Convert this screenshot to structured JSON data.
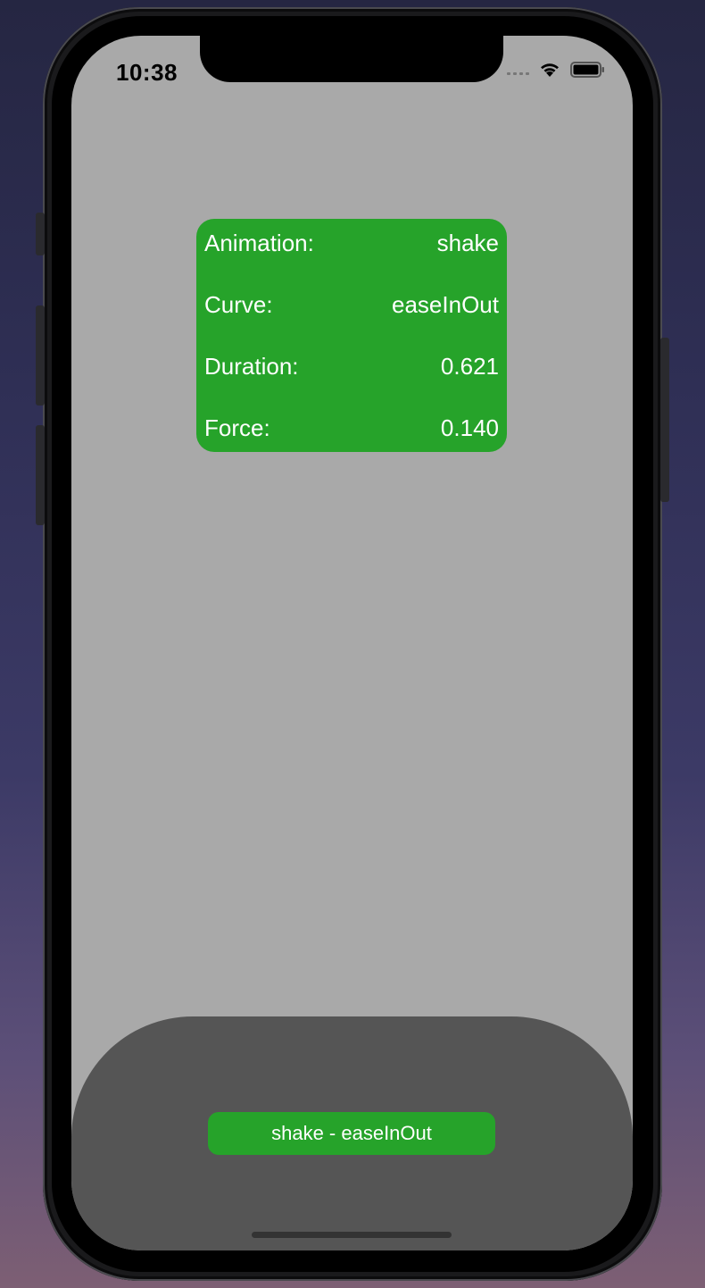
{
  "status_bar": {
    "time": "10:38",
    "icons": [
      "cellular-signal-icon",
      "wifi-icon",
      "battery-icon"
    ]
  },
  "info_card": {
    "rows": [
      {
        "label": "Animation:",
        "value": "shake"
      },
      {
        "label": "Curve:",
        "value": "easeInOut"
      },
      {
        "label": "Duration:",
        "value": "0.621"
      },
      {
        "label": "Force:",
        "value": "0.140"
      }
    ]
  },
  "action_button": {
    "label": "shake - easeInOut"
  },
  "colors": {
    "screen_bg": "#a9a9a9",
    "accent_green": "#26a32a",
    "panel_gray": "#555555"
  }
}
